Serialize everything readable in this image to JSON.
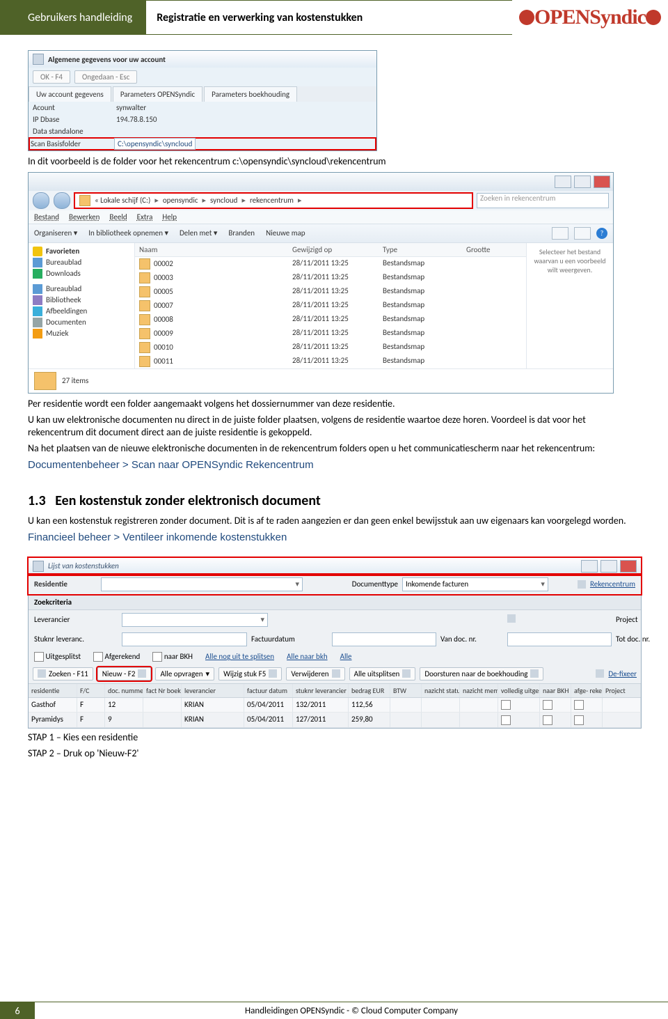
{
  "header": {
    "left": "Gebruikers handleiding",
    "center": "Registratie en verwerking van kostenstukken",
    "logo_text": "OPENSyndic"
  },
  "shot1": {
    "title": "Algemene gegevens voor uw account",
    "buttons": {
      "ok": "OK - F4",
      "undo": "Ongedaan - Esc"
    },
    "tabs": [
      "Uw account gegevens",
      "Parameters OPENSyndic",
      "Parameters boekhouding"
    ],
    "rows": {
      "acount_k": "Acount",
      "acount_v": "synwalter",
      "ip_k": "IP Dbase",
      "ip_v": "194.78.8.150",
      "ds_k": "Data standalone",
      "ds_v": "",
      "scan_k": "Scan Basisfolder",
      "scan_v": "C:\\opensyndic\\syncloud"
    }
  },
  "para1": "In dit voorbeeld is de folder voor het rekencentrum c:\\opensyndic\\syncloud\\rekencentrum",
  "explorer": {
    "breadcrumb": [
      "« Lokale schijf (C:)",
      "opensyndic",
      "syncloud",
      "rekencentrum"
    ],
    "search_placeholder": "Zoeken in rekencentrum",
    "menu": [
      "Bestand",
      "Bewerken",
      "Beeld",
      "Extra",
      "Help"
    ],
    "tools": [
      "Organiseren ▾",
      "In bibliotheek opnemen ▾",
      "Delen met ▾",
      "Branden",
      "Nieuwe map"
    ],
    "side": {
      "fav_hdr": "Favorieten",
      "items1": [
        "Bureaublad",
        "Downloads"
      ],
      "items2": [
        "Bureaublad",
        "Bibliotheek",
        "Afbeeldingen",
        "Documenten",
        "Muziek"
      ]
    },
    "cols": [
      "Naam",
      "Gewijzigd op",
      "Type",
      "Grootte"
    ],
    "rows": [
      {
        "n": "00002",
        "d": "28/11/2011 13:25",
        "t": "Bestandsmap"
      },
      {
        "n": "00003",
        "d": "28/11/2011 13:25",
        "t": "Bestandsmap"
      },
      {
        "n": "00005",
        "d": "28/11/2011 13:25",
        "t": "Bestandsmap"
      },
      {
        "n": "00007",
        "d": "28/11/2011 13:25",
        "t": "Bestandsmap"
      },
      {
        "n": "00008",
        "d": "28/11/2011 13:25",
        "t": "Bestandsmap"
      },
      {
        "n": "00009",
        "d": "28/11/2011 13:25",
        "t": "Bestandsmap"
      },
      {
        "n": "00010",
        "d": "28/11/2011 13:25",
        "t": "Bestandsmap"
      },
      {
        "n": "00011",
        "d": "28/11/2011 13:25",
        "t": "Bestandsmap"
      }
    ],
    "preview": "Selecteer het bestand waarvan u een voorbeeld wilt weergeven.",
    "status": "27 items"
  },
  "para2": "Per residentie wordt een folder aangemaakt volgens het dossiernummer van deze residentie.",
  "para3": "U kan uw elektronische documenten nu  direct in de juiste folder plaatsen, volgens de residentie waartoe deze horen. Voordeel is dat voor het rekencentrum dit document direct aan de juiste residentie is gekoppeld.",
  "para4": "Na het plaatsen van de nieuwe elektronische documenten in de rekencentrum folders open u het communicatiescherm naar het rekencentrum:",
  "navpath1": "Documentenbeheer > Scan naar OPENSyndic Rekencentrum",
  "section13_no": "1.3",
  "section13_t": "Een kostenstuk zonder elektronisch document",
  "para5": "U kan een kostenstuk registreren zonder document. Dit is af te raden aangezien er dan geen enkel bewijsstuk aan uw eigenaars kan voorgelegd worden.",
  "navpath2": "Financieel beheer > Ventileer inkomende kostenstukken",
  "app": {
    "title": "Lijst van kostenstukken",
    "res_lbl": "Residentie",
    "doc_lbl": "Documenttype",
    "doc_val": "Inkomende facturen",
    "rc_link": "Rekencentrum",
    "crit_hdr": "Zoekcriteria",
    "labels": {
      "lever": "Leverancier",
      "project": "Project",
      "stuk": "Stuknr leveranc.",
      "fdat": "Factuurdatum",
      "van": "Van doc. nr.",
      "tot": "Tot doc. nr.",
      "uitg": "Uitgesplitst",
      "afg": "Afgerekend",
      "nbkh": "naar BKH",
      "alle1": "Alle nog uit te splitsen",
      "alle2": "Alle naar bkh",
      "alle3": "Alle"
    },
    "toolbar": {
      "zoek": "Zoeken - F11",
      "nieuw": "Nieuw - F2",
      "alle": "Alle opvragen",
      "wijz": "Wijzig stuk F5",
      "verw": "Verwijderen",
      "uitspl": "Alle uitsplitsen",
      "door": "Doorsturen naar de boekhouding",
      "defix": "De-fixeer"
    },
    "cols": [
      "residentie",
      "F/C",
      "doc. nummer",
      "fact Nr boekh",
      "leverancier",
      "factuur datum",
      "stuknr leverancier",
      "bedrag EUR",
      "BTW",
      "nazicht status",
      "nazicht memo",
      "volledig uitgesplitst",
      "naar BKH",
      "afge- rekend",
      "Project"
    ],
    "rows": [
      {
        "r": "Gasthof",
        "fc": "F",
        "doc": "12",
        "fnr": "",
        "lev": "KRIAN",
        "fd": "05/04/2011",
        "sl": "132/2011",
        "bed": "112,56",
        "btw": "",
        "ns": "",
        "nm": "",
        "vu": "",
        "nb": "",
        "af": "",
        "pr": ""
      },
      {
        "r": "Pyramidys",
        "fc": "F",
        "doc": "9",
        "fnr": "",
        "lev": "KRIAN",
        "fd": "05/04/2011",
        "sl": "127/2011",
        "bed": "259,80",
        "btw": "",
        "ns": "",
        "nm": "",
        "vu": "",
        "nb": "",
        "af": "",
        "pr": ""
      }
    ]
  },
  "steps": {
    "s1": "STAP 1 – Kies een residentie",
    "s2": "STAP 2 – Druk op 'Nieuw-F2'"
  },
  "footer": {
    "page": "6",
    "text": "Handleidingen OPENSyndic - © Cloud Computer Company"
  }
}
